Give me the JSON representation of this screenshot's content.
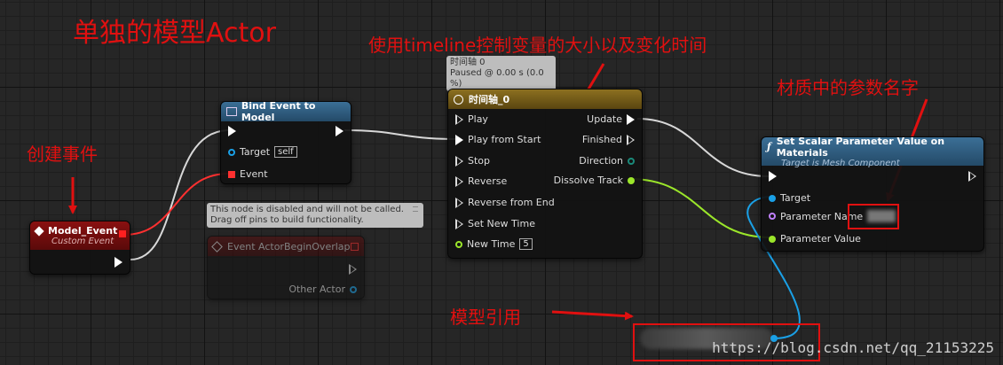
{
  "annotations": {
    "title": "单独的模型Actor",
    "timeline_note": "使用timeline控制变量的大小以及变化时间",
    "param_note": "材质中的参数名字",
    "event_note": "创建事件",
    "model_ref_note": "模型引用"
  },
  "model_event": {
    "title": "Model_Event",
    "subtitle": "Custom Event"
  },
  "bind_event": {
    "title": "Bind Event to Model",
    "pins": {
      "target": "Target",
      "target_value": "self",
      "event": "Event"
    }
  },
  "disabled_node": {
    "tooltip_line1": "This node is disabled and will not be called.",
    "tooltip_line2": "Drag off pins to build functionality.",
    "title": "Event ActorBeginOverlap",
    "pin_other_actor": "Other Actor"
  },
  "timeline": {
    "tooltip_line1": "时间轴 0",
    "tooltip_line2": "Paused @ 0.00 s (0.0 %)",
    "title": "时间轴_0",
    "inputs": [
      "Play",
      "Play from Start",
      "Stop",
      "Reverse",
      "Reverse from End",
      "Set New Time"
    ],
    "new_time_label": "New Time",
    "new_time_value": "5",
    "outputs": [
      "Update",
      "Finished",
      "Direction",
      "Dissolve Track"
    ]
  },
  "set_scalar": {
    "title": "Set Scalar Parameter Value on Materials",
    "subtitle": "Target is Mesh Component",
    "pins": {
      "target": "Target",
      "param_name": "Parameter Name",
      "param_value": "Parameter Value"
    }
  },
  "watermark": "https://blog.csdn.net/qq_21153225",
  "colors": {
    "annotation": "#e01010",
    "exec_wire": "#d8d8d8",
    "float_wire": "#9be62a",
    "object_wire": "#1aa0e6",
    "delegate_wire": "#ff3030",
    "event_header": "#7a0d0d",
    "function_header": "#2a5f86",
    "timeline_header": "#7d6418"
  }
}
